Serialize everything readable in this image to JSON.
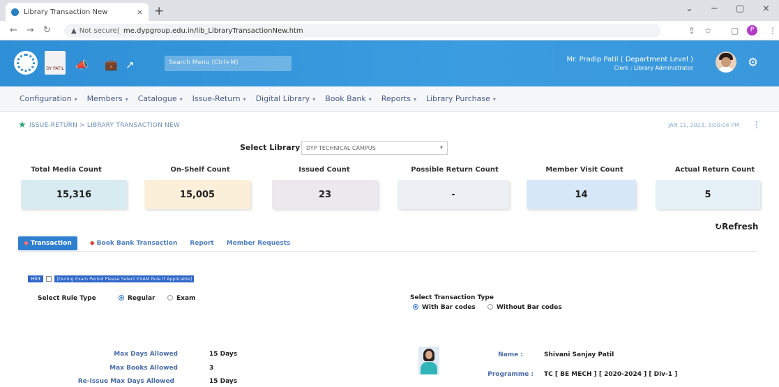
{
  "browser": {
    "tab_title": "Library Transaction New",
    "tab_close": "×",
    "new_tab": "+",
    "not_secure": "Not secure",
    "url": "me.dypgroup.edu.in/lib_LibraryTransactionNew.htm",
    "window_minimize": "−",
    "window_restore": "▢",
    "window_close": "×",
    "profile_initial": "P"
  },
  "header": {
    "logo_text": "DY PATIL",
    "search_placeholder": "Search Menu (Ctrl+M)",
    "user_name": "Mr. Pradip Patil ( Department Level )",
    "user_role": "Clerk : Library Administrator"
  },
  "menu": [
    {
      "label": "Configuration"
    },
    {
      "label": "Members"
    },
    {
      "label": "Catalogue"
    },
    {
      "label": "Issue-Return"
    },
    {
      "label": "Digital Library"
    },
    {
      "label": "Book Bank"
    },
    {
      "label": "Reports"
    },
    {
      "label": "Library Purchase"
    }
  ],
  "breadcrumb": {
    "text": "ISSUE-RETURN > LIBRARY TRANSACTION NEW",
    "datetime": "JAN 11, 2023, 3:00:04 PM"
  },
  "library": {
    "label": "Select Library",
    "selected": "DYP TECHNICAL CAMPUS"
  },
  "stats": [
    {
      "label": "Total Media Count",
      "value": "15,316",
      "color": "#d7ebf1"
    },
    {
      "label": "On-Shelf Count",
      "value": "15,005",
      "color": "#fbefd9"
    },
    {
      "label": "Issued Count",
      "value": "23",
      "color": "#ebe8ee"
    },
    {
      "label": "Possible Return Count",
      "value": "-",
      "color": "#eceff3"
    },
    {
      "label": "Member Visit Count",
      "value": "14",
      "color": "#d6e7f7"
    },
    {
      "label": "Actual Return Count",
      "value": "5",
      "color": "#e6f0f7"
    }
  ],
  "refresh_label": "Refresh",
  "tabs": [
    {
      "label": "Transaction",
      "active": true
    },
    {
      "label": "Book Bank Transaction",
      "active": false
    },
    {
      "label": "Report",
      "active": false
    },
    {
      "label": "Member Requests",
      "active": false
    }
  ],
  "hint": {
    "badge": "Hint",
    "text": "[During Exam Period Please Select EXAM Rule If Applicable]"
  },
  "rule_type": {
    "label": "Select Rule Type",
    "options": [
      "Regular",
      "Exam"
    ],
    "selected": "Regular"
  },
  "transaction_type": {
    "label": "Select Transaction Type",
    "options": [
      "With Bar codes",
      "Without Bar codes"
    ],
    "selected": "With Bar codes"
  },
  "limits": [
    {
      "label": "Max Days Allowed",
      "value": "15 Days"
    },
    {
      "label": "Max Books Allowed",
      "value": "3"
    },
    {
      "label": "Re-Issue Max Days Allowed",
      "value": "15 Days"
    }
  ],
  "member": {
    "name_label": "Name :",
    "name": "Shivani Sanjay Patil",
    "programme_label": "Programme :",
    "programme": "TC [ BE MECH ] [ 2020-2024 ] [ Div-1 ]"
  }
}
